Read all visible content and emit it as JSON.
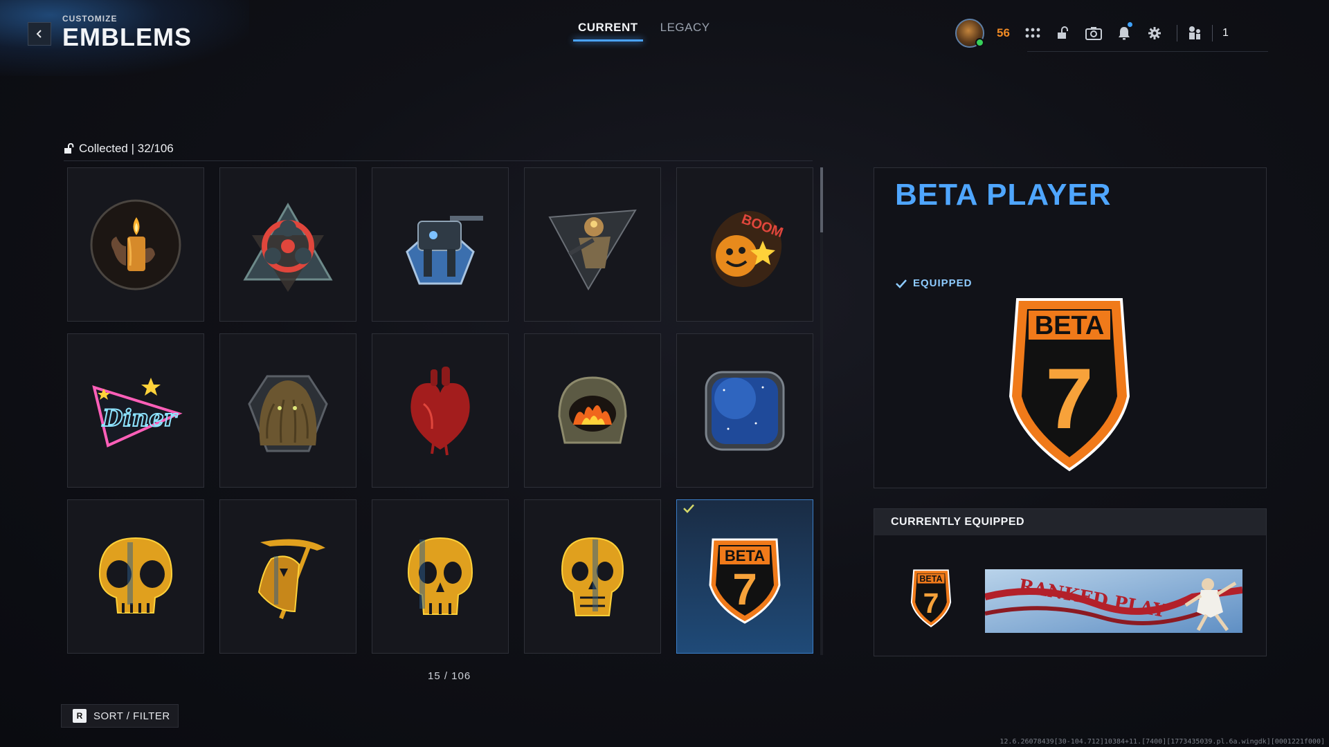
{
  "header": {
    "subtitle": "CUSTOMIZE",
    "title": "EMBLEMS"
  },
  "tabs": [
    {
      "label": "CURRENT",
      "active": true
    },
    {
      "label": "LEGACY",
      "active": false
    }
  ],
  "topbar": {
    "level": "56",
    "party_count": "1",
    "icons": [
      "menu-grid-icon",
      "lock-icon",
      "camera-icon",
      "bell-icon",
      "gear-icon",
      "party-icon"
    ],
    "accent": "#4aa3ff",
    "level_color": "#f08a24"
  },
  "collection": {
    "label": "Collected | 32/106"
  },
  "emblems": [
    {
      "icon": "candle-hand-emblem"
    },
    {
      "icon": "biohazard-emblem"
    },
    {
      "icon": "mech-turret-emblem"
    },
    {
      "icon": "soldier-triangle-emblem"
    },
    {
      "icon": "boom-bomb-emblem"
    },
    {
      "icon": "diner-neon-emblem",
      "text": "Diner"
    },
    {
      "icon": "furry-creature-emblem"
    },
    {
      "icon": "anatomical-heart-emblem"
    },
    {
      "icon": "flaming-helmet-emblem"
    },
    {
      "icon": "space-window-emblem"
    },
    {
      "icon": "gold-skull-emblem"
    },
    {
      "icon": "gold-reaper-emblem"
    },
    {
      "icon": "gold-skull-emblem-2"
    },
    {
      "icon": "gold-skull-emblem-3"
    },
    {
      "icon": "beta-7-emblem",
      "text": "BETA",
      "number": "7",
      "selected": true,
      "equipped": true
    }
  ],
  "pager": "15 / 106",
  "sort_filter": {
    "key": "R",
    "label": "SORT / FILTER"
  },
  "detail": {
    "title": "BETA PLAYER",
    "status": "EQUIPPED",
    "emblem_text": "BETA",
    "emblem_number": "7"
  },
  "currently_equipped": {
    "header": "CURRENTLY EQUIPPED",
    "emblem_text": "BETA",
    "emblem_number": "7",
    "calling_card_text": "RANKED PLAY"
  },
  "footer": {
    "build": "12.6.26078439[30-104.712]10384+11.[7400][1773435039.pl.6a.wingdk][0001221f000]"
  }
}
